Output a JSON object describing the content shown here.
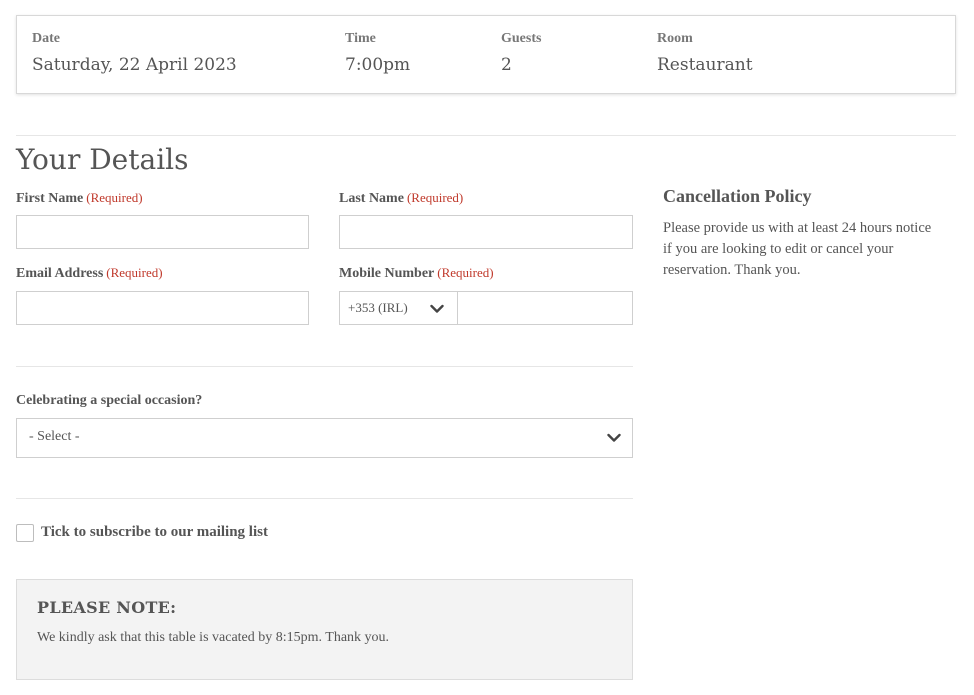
{
  "summary": {
    "date_label": "Date",
    "date_value": "Saturday, 22 April 2023",
    "time_label": "Time",
    "time_value": "7:00pm",
    "guests_label": "Guests",
    "guests_value": "2",
    "room_label": "Room",
    "room_value": "Restaurant"
  },
  "details": {
    "title": "Your Details",
    "required_tag": "(Required)",
    "first_name_label": "First Name",
    "first_name_value": "",
    "last_name_label": "Last Name",
    "last_name_value": "",
    "email_label": "Email Address",
    "email_value": "",
    "mobile_label": "Mobile Number",
    "country_code_selected": "+353 (IRL)",
    "mobile_value": ""
  },
  "occasion": {
    "label": "Celebrating a special occasion?",
    "selected": "- Select -"
  },
  "mailing_list": {
    "label": "Tick to subscribe to our mailing list",
    "checked": false
  },
  "note": {
    "title": "PLEASE NOTE:",
    "text": "We kindly ask that this table is vacated by 8:15pm. Thank you."
  },
  "cancellation": {
    "title": "Cancellation Policy",
    "text": "Please provide us with at least 24 hours notice if you are looking to edit or cancel your reservation. Thank you."
  },
  "icons": {
    "dropdown": "chevron-down-icon"
  },
  "colors": {
    "required": "#c0392b",
    "text": "#555555",
    "border": "#cfcfcf",
    "note_bg": "#f3f3f3"
  }
}
